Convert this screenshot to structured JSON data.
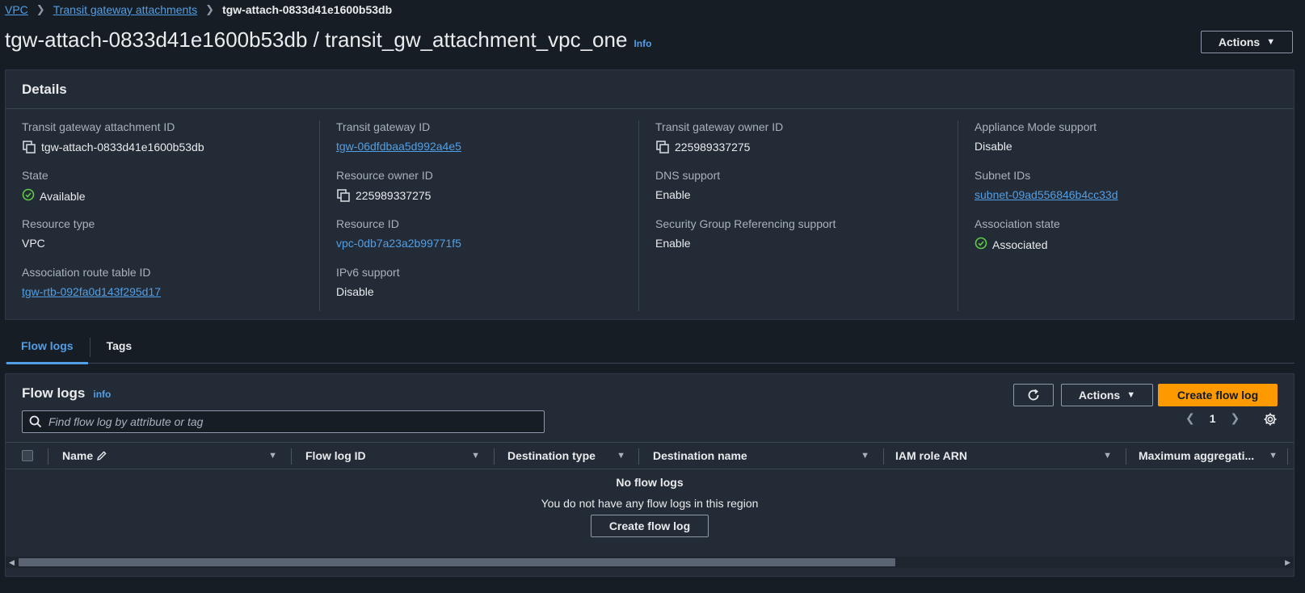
{
  "breadcrumb": {
    "items": [
      "VPC",
      "Transit gateway attachments"
    ],
    "current": "tgw-attach-0833d41e1600b53db"
  },
  "page": {
    "title": "tgw-attach-0833d41e1600b53db / transit_gw_attachment_vpc_one",
    "info": "Info",
    "actions_label": "Actions"
  },
  "details": {
    "header": "Details",
    "fields": {
      "attachment_id": {
        "label": "Transit gateway attachment ID",
        "value": "tgw-attach-0833d41e1600b53db"
      },
      "state": {
        "label": "State",
        "value": "Available"
      },
      "resource_type": {
        "label": "Resource type",
        "value": "VPC"
      },
      "assoc_route_table": {
        "label": "Association route table ID",
        "value": "tgw-rtb-092fa0d143f295d17"
      },
      "tgw_id": {
        "label": "Transit gateway ID",
        "value": "tgw-06dfdbaa5d992a4e5"
      },
      "resource_owner": {
        "label": "Resource owner ID",
        "value": "225989337275"
      },
      "resource_id": {
        "label": "Resource ID",
        "value": "vpc-0db7a23a2b99771f5"
      },
      "ipv6": {
        "label": "IPv6 support",
        "value": "Disable"
      },
      "tgw_owner": {
        "label": "Transit gateway owner ID",
        "value": "225989337275"
      },
      "dns": {
        "label": "DNS support",
        "value": "Enable"
      },
      "sg_ref": {
        "label": "Security Group Referencing support",
        "value": "Enable"
      },
      "appliance": {
        "label": "Appliance Mode support",
        "value": "Disable"
      },
      "subnets": {
        "label": "Subnet IDs",
        "value": "subnet-09ad556846b4cc33d"
      },
      "assoc_state": {
        "label": "Association state",
        "value": "Associated"
      }
    }
  },
  "tabs": [
    {
      "label": "Flow logs",
      "active": true
    },
    {
      "label": "Tags",
      "active": false
    }
  ],
  "flow_logs": {
    "title": "Flow logs",
    "info": "info",
    "actions_label": "Actions",
    "create_label": "Create flow log",
    "search_placeholder": "Find flow log by attribute or tag",
    "page": "1",
    "columns": [
      "Name",
      "Flow log ID",
      "Destination type",
      "Destination name",
      "IAM role ARN",
      "Maximum aggregati..."
    ],
    "empty_title": "No flow logs",
    "empty_desc": "You do not have any flow logs in this region",
    "empty_button": "Create flow log"
  },
  "colors": {
    "accent": "#539fe5",
    "primary_button": "#ff9900",
    "success": "#5fcc44",
    "background": "#171d25",
    "panel": "#232b36"
  }
}
